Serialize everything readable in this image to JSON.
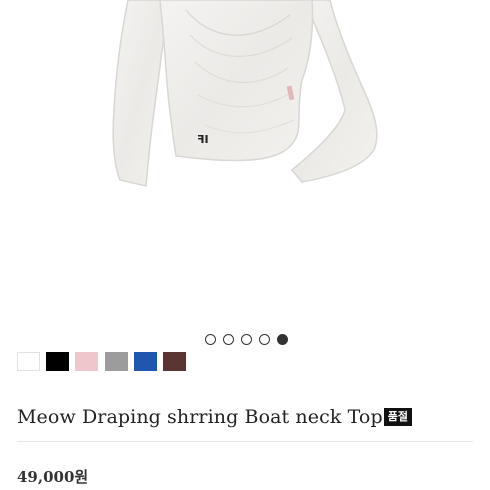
{
  "product": {
    "title": "Meow Draping shrring Boat neck Top",
    "status_badge": "품절",
    "price": "49,000원"
  },
  "gallery": {
    "image_count": 5,
    "active_index": 5
  },
  "colors": [
    {
      "name": "white",
      "hex": "#ffffff"
    },
    {
      "name": "black",
      "hex": "#000000"
    },
    {
      "name": "pink",
      "hex": "#efc6cc"
    },
    {
      "name": "gray",
      "hex": "#9c9c9c"
    },
    {
      "name": "blue",
      "hex": "#1e56b0"
    },
    {
      "name": "brown",
      "hex": "#5a3533"
    }
  ]
}
